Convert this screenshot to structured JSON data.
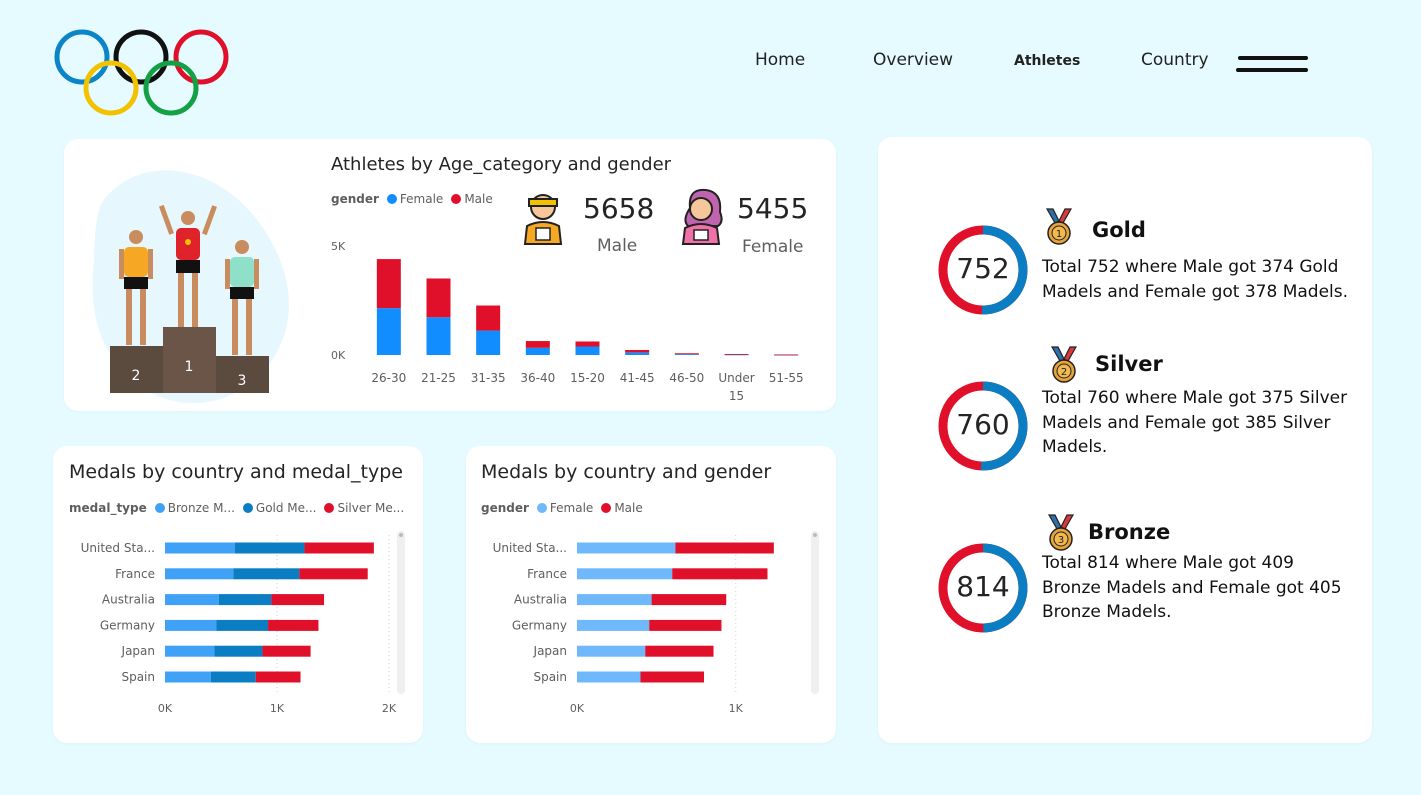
{
  "nav": {
    "items": [
      "Home",
      "Overview",
      "Athletes",
      "Country"
    ],
    "active": "Athletes"
  },
  "colors": {
    "female": "#118dff",
    "male": "#e0102b",
    "bronze_medal": "#3fa2f7",
    "gold_medal": "#0b7dc2",
    "silver_medal": "#e0102b",
    "female_light": "#6fb8fb",
    "background": "#e6fbff"
  },
  "age_chart": {
    "title": "Athletes by Age_category and gender",
    "legend_title": "gender",
    "legend": [
      "Female",
      "Male"
    ],
    "male_total": "5658",
    "male_label": "Male",
    "female_total": "5455",
    "female_label": "Female",
    "podium_labels": [
      "2",
      "1",
      "3"
    ]
  },
  "medal_type_chart": {
    "title": "Medals by country and medal_type",
    "legend_title": "medal_type",
    "legend": [
      "Bronze M...",
      "Gold Me...",
      "Silver Me..."
    ]
  },
  "gender_country_chart": {
    "title": "Medals by country and gender",
    "legend_title": "gender",
    "legend": [
      "Female",
      "Male"
    ]
  },
  "medals": [
    {
      "name": "Gold",
      "total": "752",
      "rank": "1",
      "male_fraction": 0.497,
      "desc": "Total 752 where Male got 374 Gold Madels and Female got 378 Madels."
    },
    {
      "name": "Silver",
      "total": "760",
      "rank": "2",
      "male_fraction": 0.493,
      "desc": "Total 760 where Male got 375 Silver Madels and Female got 385 Silver Madels."
    },
    {
      "name": "Bronze",
      "total": "814",
      "rank": "3",
      "male_fraction": 0.502,
      "desc": "Total 814 where Male got 409 Bronze Madels and Female got 405 Bronze Madels."
    }
  ],
  "chart_data": [
    {
      "type": "bar",
      "title": "Athletes by Age_category and gender",
      "categories": [
        "26-30",
        "21-25",
        "31-35",
        "36-40",
        "15-20",
        "41-45",
        "46-50",
        "Under 15",
        "51-55"
      ],
      "series": [
        {
          "name": "Female",
          "values": [
            2150,
            1730,
            1120,
            330,
            390,
            120,
            40,
            25,
            12
          ]
        },
        {
          "name": "Male",
          "values": [
            2250,
            1780,
            1150,
            310,
            230,
            110,
            40,
            20,
            12
          ]
        }
      ],
      "yticks": [
        "0K",
        "5K"
      ],
      "ylim": [
        0,
        5000
      ],
      "stacked": true
    },
    {
      "type": "bar",
      "orientation": "horizontal",
      "title": "Medals by country and medal_type",
      "categories": [
        "United Sta...",
        "France",
        "Australia",
        "Germany",
        "Japan",
        "Spain"
      ],
      "series": [
        {
          "name": "Bronze M...",
          "values": [
            625,
            610,
            480,
            460,
            440,
            410
          ]
        },
        {
          "name": "Gold Me...",
          "values": [
            620,
            590,
            470,
            460,
            430,
            400
          ]
        },
        {
          "name": "Silver Me...",
          "values": [
            620,
            610,
            470,
            450,
            430,
            400
          ]
        }
      ],
      "xticks": [
        "0K",
        "1K",
        "2K"
      ],
      "xlim": [
        0,
        2000
      ],
      "stacked": true
    },
    {
      "type": "bar",
      "orientation": "horizontal",
      "title": "Medals by country and gender",
      "categories": [
        "United Sta...",
        "France",
        "Australia",
        "Germany",
        "Japan",
        "Spain"
      ],
      "series": [
        {
          "name": "Female",
          "values": [
            620,
            600,
            470,
            455,
            430,
            400
          ]
        },
        {
          "name": "Male",
          "values": [
            620,
            600,
            470,
            455,
            430,
            400
          ]
        }
      ],
      "xticks": [
        "0K",
        "1K"
      ],
      "xlim": [
        0,
        1600
      ],
      "stacked": true
    }
  ]
}
